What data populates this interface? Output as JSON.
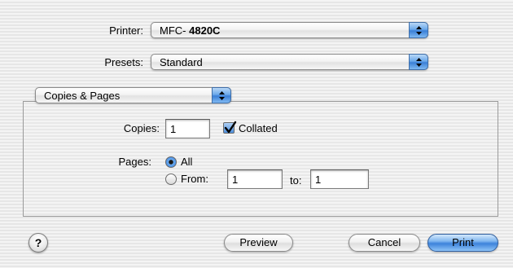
{
  "printer": {
    "label": "Printer:",
    "value_prefix": "MFC-",
    "value_model": "4820C"
  },
  "presets": {
    "label": "Presets:",
    "value": "Standard"
  },
  "panel": {
    "value": "Copies & Pages"
  },
  "copies": {
    "label": "Copies:",
    "value": "1",
    "collated_label": "Collated",
    "collated_checked": true
  },
  "pages": {
    "label": "Pages:",
    "all_label": "All",
    "from_label": "From:",
    "from_value": "1",
    "to_label": "to:",
    "to_value": "1",
    "selected": "All"
  },
  "buttons": {
    "help": "?",
    "preview": "Preview",
    "cancel": "Cancel",
    "print": "Print"
  },
  "colors": {
    "accent": "#3c82db"
  },
  "icons": {
    "popup": "up-down-arrows-icon",
    "check": "checkmark-icon",
    "help": "help-icon"
  }
}
